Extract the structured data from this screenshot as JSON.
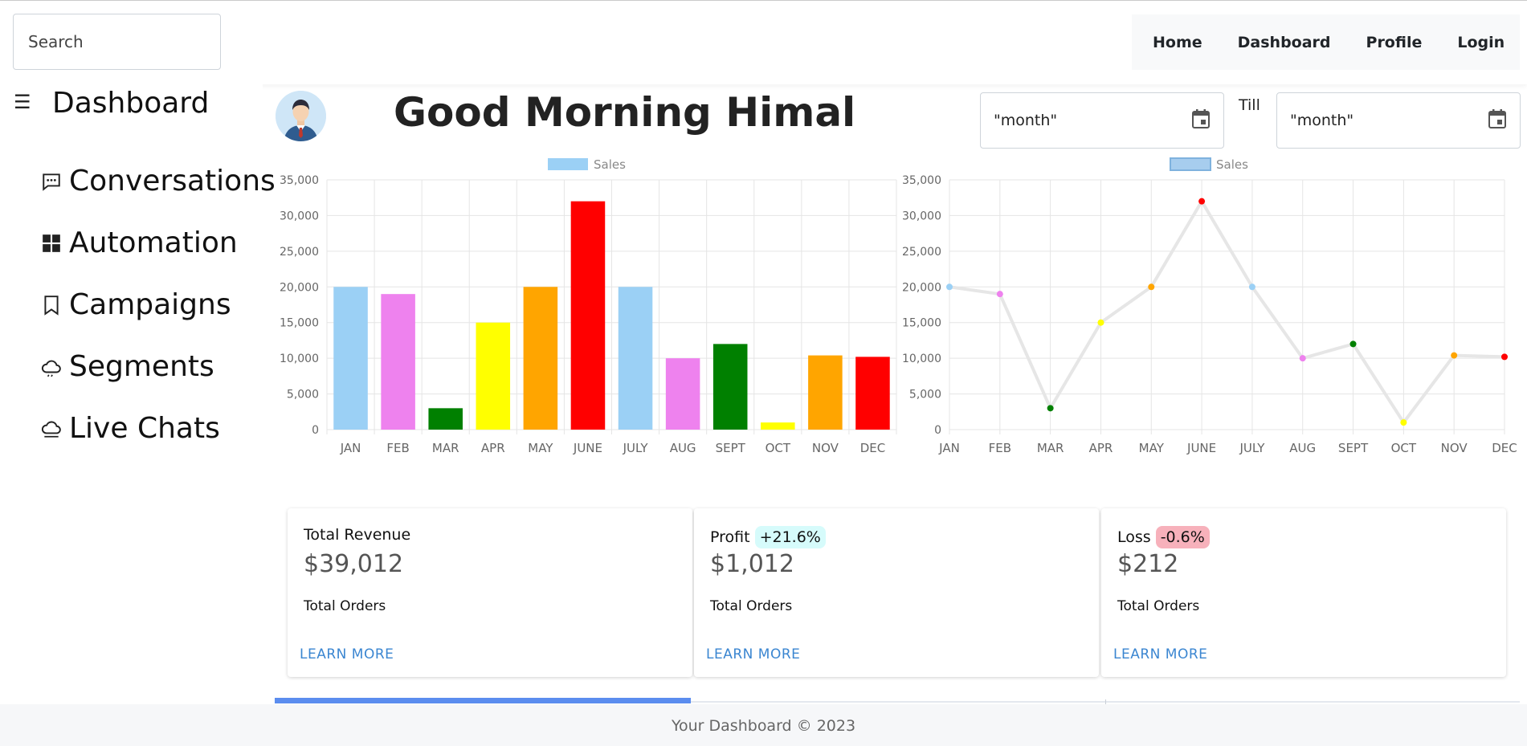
{
  "search": {
    "placeholder": "Search"
  },
  "nav": {
    "links": [
      "Home",
      "Dashboard",
      "Profile",
      "Login"
    ]
  },
  "sidebar": {
    "title": "Dashboard",
    "items": [
      {
        "label": "Conversations",
        "icon": "chat-dots-icon"
      },
      {
        "label": "Automation",
        "icon": "grid-icon"
      },
      {
        "label": "Campaigns",
        "icon": "bookmark-icon"
      },
      {
        "label": "Segments",
        "icon": "cloud-icon"
      },
      {
        "label": "Live Chats",
        "icon": "cloud-icon"
      }
    ]
  },
  "header": {
    "greeting": "Good Morning Himal",
    "from_value": "\"month\"",
    "till_label": "Till",
    "till_value": "\"month\""
  },
  "chart_data": [
    {
      "type": "bar",
      "legend": "Sales",
      "categories": [
        "JAN",
        "FEB",
        "MAR",
        "APR",
        "MAY",
        "JUNE",
        "JULY",
        "AUG",
        "SEPT",
        "OCT",
        "NOV",
        "DEC"
      ],
      "values": [
        20000,
        19000,
        3000,
        15000,
        20000,
        32000,
        20000,
        10000,
        12000,
        1000,
        10400,
        10200
      ],
      "colors": [
        "#9bd0f5",
        "#ee82ee",
        "#008000",
        "#ffff00",
        "#ffa500",
        "#ff0000",
        "#9bd0f5",
        "#ee82ee",
        "#008000",
        "#ffff00",
        "#ffa500",
        "#ff0000"
      ],
      "ylim": [
        0,
        35000
      ],
      "yticks": [
        "0",
        "5,000",
        "10,000",
        "15,000",
        "20,000",
        "25,000",
        "30,000",
        "35,000"
      ],
      "grid": true,
      "legend_position": "top"
    },
    {
      "type": "line",
      "legend": "Sales",
      "categories": [
        "JAN",
        "FEB",
        "MAR",
        "APR",
        "MAY",
        "JUNE",
        "JULY",
        "AUG",
        "SEPT",
        "OCT",
        "NOV",
        "DEC"
      ],
      "values": [
        20000,
        19000,
        3000,
        15000,
        20000,
        32000,
        20000,
        10000,
        12000,
        1000,
        10400,
        10200
      ],
      "colors": [
        "#9bd0f5",
        "#ee82ee",
        "#008000",
        "#ffff00",
        "#ffa500",
        "#ff0000",
        "#9bd0f5",
        "#ee82ee",
        "#008000",
        "#ffff00",
        "#ffa500",
        "#ff0000"
      ],
      "line_color": "#e6e6e6",
      "ylim": [
        0,
        35000
      ],
      "yticks": [
        "0",
        "5,000",
        "10,000",
        "15,000",
        "20,000",
        "25,000",
        "30,000",
        "35,000"
      ],
      "grid": true,
      "legend_position": "top"
    }
  ],
  "cards": [
    {
      "title": "Total Revenue",
      "badge": "",
      "badge_color": "",
      "value": "$39,012",
      "sub": "Total Orders",
      "link": "LEARN MORE"
    },
    {
      "title": "Profit",
      "badge": "+21.6%",
      "badge_color": "#d6fbfb",
      "value": "$1,012",
      "sub": "Total Orders",
      "link": "LEARN MORE"
    },
    {
      "title": "Loss",
      "badge": "-0.6%",
      "badge_color": "#f7b1bb",
      "value": "$212",
      "sub": "Total Orders",
      "link": "LEARN MORE"
    }
  ],
  "footer": {
    "text": "Your Dashboard © 2023"
  }
}
